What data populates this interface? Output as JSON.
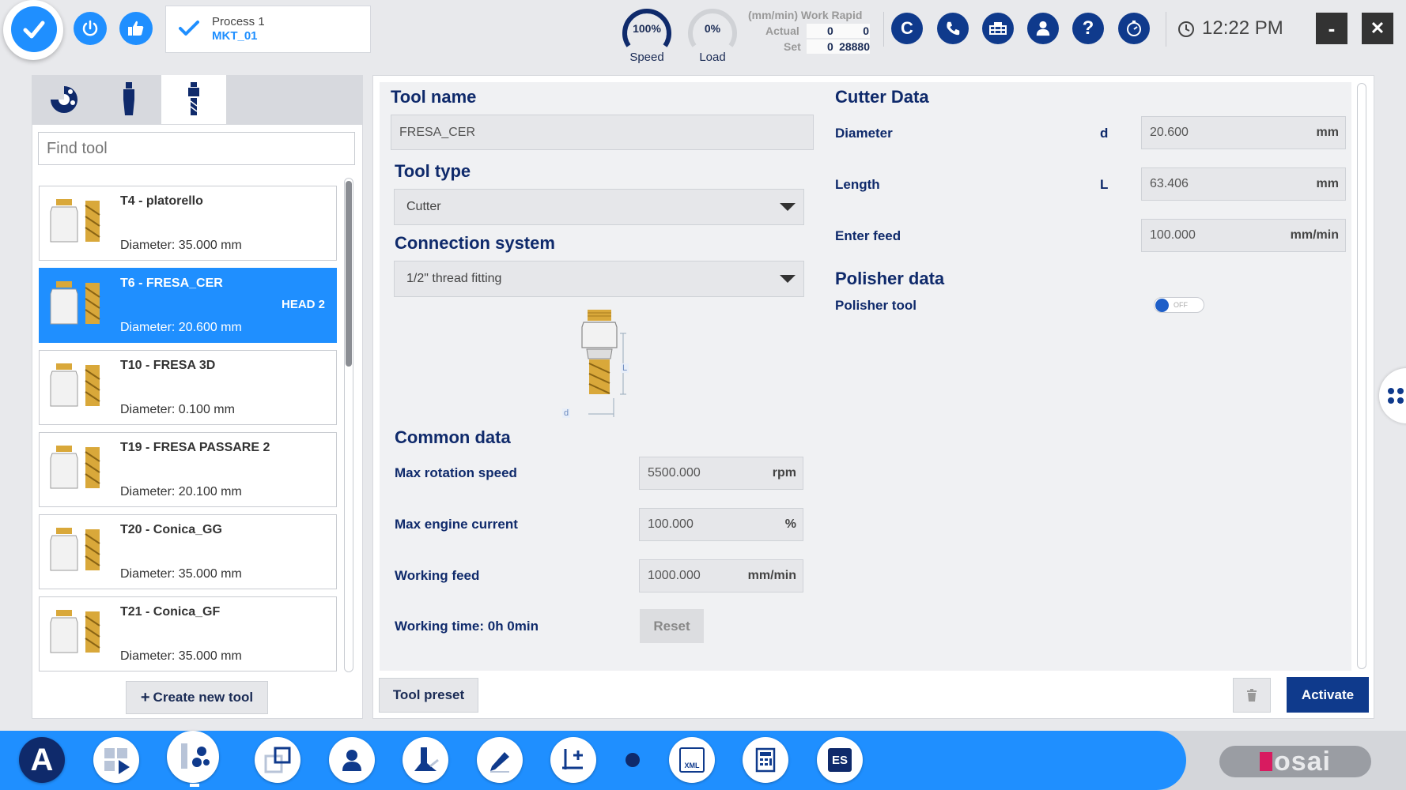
{
  "process": {
    "name": "Process 1",
    "program": "MKT_01"
  },
  "gauges": {
    "speed": {
      "value": "100%",
      "label": "Speed",
      "fraction": 1.0
    },
    "load": {
      "value": "0%",
      "label": "Load",
      "fraction": 0.0
    }
  },
  "work_rapid": {
    "title": "(mm/min) Work Rapid",
    "actual_label": "Actual",
    "set_label": "Set",
    "actual_work": "0",
    "actual_rapid": "0",
    "set_work": "0",
    "set_rapid": "28880"
  },
  "nav_icons": [
    "c-icon",
    "phone-icon",
    "machine-icon",
    "user-icon",
    "help-icon",
    "timer-icon"
  ],
  "nav_c_label": "C",
  "nav_help_label": "?",
  "clock": "12:22 PM",
  "window": {
    "minimize": "-",
    "close": "✕"
  },
  "search": {
    "placeholder": "Find tool"
  },
  "tools": [
    {
      "name": "T4 - platorello",
      "diameter": "Diameter: 35.000 mm",
      "head": "",
      "selected": false
    },
    {
      "name": "T6 - FRESA_CER",
      "diameter": "Diameter: 20.600 mm",
      "head": "HEAD 2",
      "selected": true
    },
    {
      "name": "T10 - FRESA 3D",
      "diameter": "Diameter: 0.100 mm",
      "head": "",
      "selected": false
    },
    {
      "name": "T19 - FRESA PASSARE 2",
      "diameter": "Diameter: 20.100 mm",
      "head": "",
      "selected": false
    },
    {
      "name": "T20 - Conica_GG",
      "diameter": "Diameter: 35.000 mm",
      "head": "",
      "selected": false
    },
    {
      "name": "T21 - Conica_GF",
      "diameter": "Diameter: 35.000 mm",
      "head": "",
      "selected": false
    }
  ],
  "create_tool_label": "Create new tool",
  "form": {
    "tool_name_title": "Tool name",
    "tool_name_value": "FRESA_CER",
    "tool_type_title": "Tool type",
    "tool_type_value": "Cutter",
    "connection_title": "Connection system",
    "connection_value": "1/2\" thread fitting",
    "diagram_d": "d",
    "diagram_l": "L",
    "common_title": "Common data",
    "max_rot_label": "Max rotation speed",
    "max_rot_value": "5500.000",
    "max_rot_unit": "rpm",
    "max_cur_label": "Max engine current",
    "max_cur_value": "100.000",
    "max_cur_unit": "%",
    "work_feed_label": "Working feed",
    "work_feed_value": "1000.000",
    "work_feed_unit": "mm/min",
    "work_time_label": "Working time: 0h 0min",
    "reset_label": "Reset"
  },
  "cutter": {
    "title": "Cutter Data",
    "diameter_label": "Diameter",
    "diameter_sym": "d",
    "diameter_value": "20.600",
    "diameter_unit": "mm",
    "length_label": "Length",
    "length_sym": "L",
    "length_value": "63.406",
    "length_unit": "mm",
    "feed_label": "Enter feed",
    "feed_value": "100.000",
    "feed_unit": "mm/min",
    "polisher_title": "Polisher data",
    "polisher_label": "Polisher tool",
    "polisher_state": "OFF"
  },
  "footer": {
    "preset_label": "Tool preset",
    "activate_label": "Activate"
  },
  "bottom_bar": {
    "a_label": "A",
    "es_label": "ES",
    "xml_label": "XML",
    "logo": "osai"
  },
  "colors": {
    "accent": "#1f8fff",
    "navy": "#0f3a8c",
    "tool_gold": "#d9a83a"
  }
}
